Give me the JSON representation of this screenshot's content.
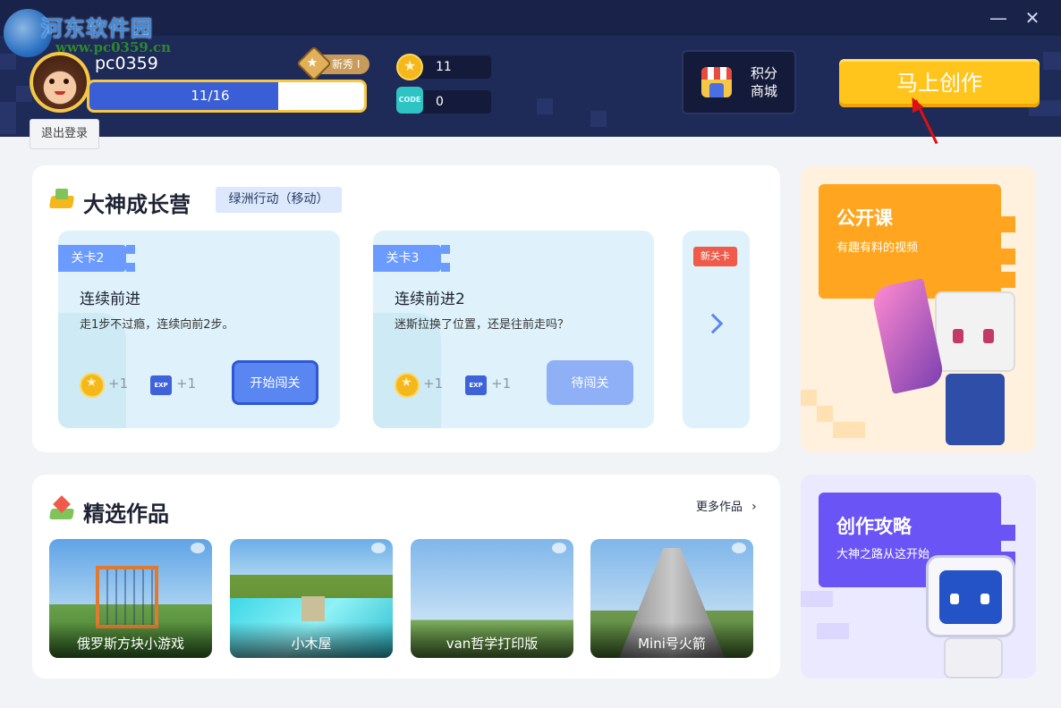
{
  "watermark": {
    "name": "河东软件园",
    "url": "www.pc0359.cn"
  },
  "window": {
    "minimize": "—",
    "close": "✕"
  },
  "user": {
    "name": "pc0359",
    "rank": "新秀 I",
    "xp_text": "11/16",
    "xp_progress": 0.6875,
    "logout": "退出登录"
  },
  "currency": {
    "coins": "11",
    "code_label": "CODE",
    "codes": "0"
  },
  "shop": {
    "label": "积分商城"
  },
  "create": {
    "label": "马上创作"
  },
  "camp": {
    "title": "大神成长营",
    "mode": "绿洲行动（移动）",
    "levels": [
      {
        "tag": "关卡2",
        "name": "连续前进",
        "desc": "走1步不过瘾，连续向前2步。",
        "coin_reward": "+1",
        "exp_label": "EXP",
        "exp_reward": "+1",
        "button": "开始闯关"
      },
      {
        "tag": "关卡3",
        "name": "连续前进2",
        "desc": "迷斯拉换了位置，还是往前走吗？",
        "coin_reward": "+1",
        "exp_label": "EXP",
        "exp_reward": "+1",
        "button": "待闯关"
      }
    ],
    "new_level_badge": "新关卡"
  },
  "featured": {
    "title": "精选作品",
    "more": "更多作品",
    "works": [
      {
        "label": "俄罗斯方块小游戏"
      },
      {
        "label": "小木屋"
      },
      {
        "label": "van哲学打印版"
      },
      {
        "label": "Mini号火箭"
      }
    ]
  },
  "promos": [
    {
      "title": "公开课",
      "subtitle": "有趣有料的视频",
      "color": "#ffa51f"
    },
    {
      "title": "创作攻略",
      "subtitle": "大神之路从这开始",
      "color": "#6b54f5"
    }
  ]
}
